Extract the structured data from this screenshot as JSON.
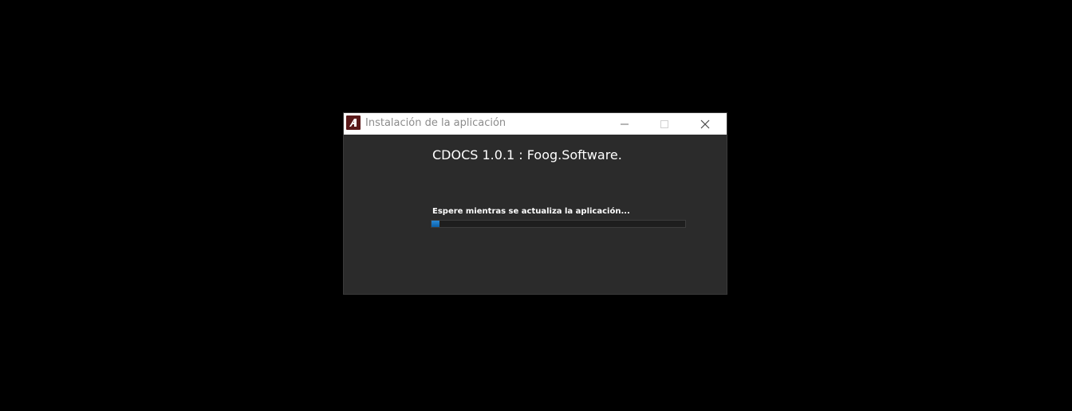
{
  "window": {
    "title": "Instalación de la aplicación",
    "controls": {
      "minimize": "minimize-icon",
      "maximize": "maximize-icon",
      "close": "close-icon"
    }
  },
  "main": {
    "app_title": "CDOCS 1.0.1 : Foog.Software.",
    "status_text": "Espere mientras se actualiza la aplicación...",
    "progress_percent": 3
  },
  "colors": {
    "background": "#000000",
    "window_body": "#2b2b2b",
    "titlebar": "#ffffff",
    "progress_fill": "#1a73c0",
    "icon_background": "#5a1a1a"
  }
}
